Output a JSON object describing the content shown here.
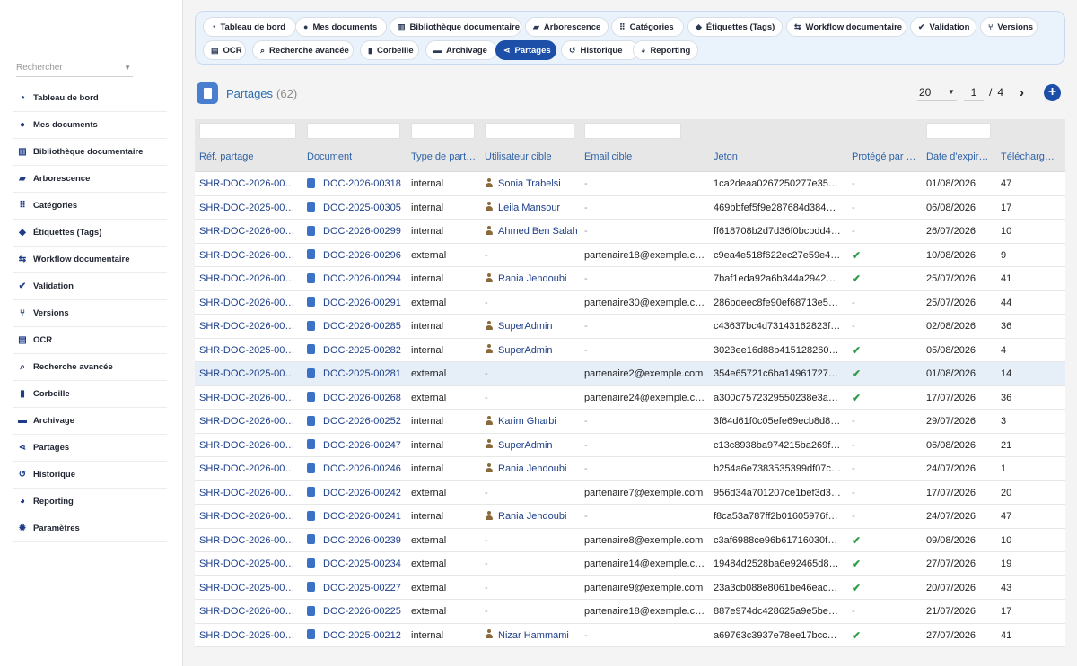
{
  "sidebar": {
    "search_placeholder": "Rechercher",
    "items": [
      {
        "label": "Tableau de bord",
        "icon": "dashboard-icon"
      },
      {
        "label": "Mes documents",
        "icon": "user-icon"
      },
      {
        "label": "Bibliothèque documentaire",
        "icon": "book-icon"
      },
      {
        "label": "Arborescence",
        "icon": "folder-icon"
      },
      {
        "label": "Catégories",
        "icon": "sitemap-icon"
      },
      {
        "label": "Étiquettes (Tags)",
        "icon": "tag-icon"
      },
      {
        "label": "Workflow documentaire",
        "icon": "workflow-icon"
      },
      {
        "label": "Validation",
        "icon": "check-circle-icon"
      },
      {
        "label": "Versions",
        "icon": "branch-icon"
      },
      {
        "label": "OCR",
        "icon": "file-text-icon"
      },
      {
        "label": "Recherche avancée",
        "icon": "search-icon"
      },
      {
        "label": "Corbeille",
        "icon": "trash-icon"
      },
      {
        "label": "Archivage",
        "icon": "archive-icon"
      },
      {
        "label": "Partages",
        "icon": "share-icon"
      },
      {
        "label": "Historique",
        "icon": "history-icon"
      },
      {
        "label": "Reporting",
        "icon": "pie-chart-icon"
      },
      {
        "label": "Paramètres",
        "icon": "gear-icon"
      }
    ]
  },
  "tabs": [
    {
      "label": "Tableau de bord",
      "icon": "dashboard-icon"
    },
    {
      "label": "Mes documents",
      "icon": "user-icon"
    },
    {
      "label": "Bibliothèque documentaire",
      "icon": "book-icon"
    },
    {
      "label": "Arborescence",
      "icon": "folder-icon"
    },
    {
      "label": "Catégories",
      "icon": "sitemap-icon"
    },
    {
      "label": "Étiquettes (Tags)",
      "icon": "tag-icon"
    },
    {
      "label": "Workflow documentaire",
      "icon": "workflow-icon"
    },
    {
      "label": "Validation",
      "icon": "check-circle-icon"
    },
    {
      "label": "Versions",
      "icon": "branch-icon"
    },
    {
      "label": "OCR",
      "icon": "file-text-icon"
    },
    {
      "label": "Recherche avancée",
      "icon": "search-icon"
    },
    {
      "label": "Corbeille",
      "icon": "trash-icon"
    },
    {
      "label": "Archivage",
      "icon": "archive-icon"
    },
    {
      "label": "Partages",
      "icon": "share-icon",
      "active": true
    },
    {
      "label": "Historique",
      "icon": "history-icon"
    },
    {
      "label": "Reporting",
      "icon": "pie-chart-icon"
    }
  ],
  "page": {
    "title": "Partages",
    "count": "(62)"
  },
  "pager": {
    "page_size": "20",
    "current": "1",
    "separator": "/",
    "total": "4"
  },
  "colors": {
    "accent": "#1d4fa8",
    "link": "#1c3f8a",
    "header_text": "#2f63a8",
    "check": "#2e9c4a"
  },
  "table": {
    "columns": [
      "Réf. partage",
      "Document",
      "Type de partage",
      "Utilisateur cible",
      "Email cible",
      "Jeton",
      "Protégé par mot de passe",
      "Date d'expiration",
      "Téléchargements"
    ],
    "highlight_row": 8,
    "rows": [
      {
        "ref": "SHR-DOC-2026-00318",
        "doc": "DOC-2026-00318",
        "type": "internal",
        "user": "Sonia Trabelsi",
        "email": "-",
        "token": "1ca2deaa0267250277e350…",
        "protected": "-",
        "date": "01/08/2026",
        "downloads": "47"
      },
      {
        "ref": "SHR-DOC-2025-00305",
        "doc": "DOC-2025-00305",
        "type": "internal",
        "user": "Leila Mansour",
        "email": "-",
        "token": "469bbfef5f9e287684d38400…",
        "protected": "-",
        "date": "06/08/2026",
        "downloads": "17"
      },
      {
        "ref": "SHR-DOC-2026-00299",
        "doc": "DOC-2026-00299",
        "type": "internal",
        "user": "Ahmed Ben Salah",
        "email": "-",
        "token": "ff618708b2d7d36f0bcbdd44…",
        "protected": "-",
        "date": "26/07/2026",
        "downloads": "10"
      },
      {
        "ref": "SHR-DOC-2026-00296",
        "doc": "DOC-2026-00296",
        "type": "external",
        "user": "-",
        "email": "partenaire18@exemple.com",
        "token": "c9ea4e518f622ec27e59e49…",
        "protected": "check",
        "date": "10/08/2026",
        "downloads": "9"
      },
      {
        "ref": "SHR-DOC-2026-00294",
        "doc": "DOC-2026-00294",
        "type": "internal",
        "user": "Rania Jendoubi",
        "email": "-",
        "token": "7baf1eda92a6b344a2942e8…",
        "protected": "check",
        "date": "25/07/2026",
        "downloads": "41"
      },
      {
        "ref": "SHR-DOC-2026-00291",
        "doc": "DOC-2026-00291",
        "type": "external",
        "user": "-",
        "email": "partenaire30@exemple.com",
        "token": "286bdeec8fe90ef68713e58f…",
        "protected": "-",
        "date": "25/07/2026",
        "downloads": "44"
      },
      {
        "ref": "SHR-DOC-2026-00285",
        "doc": "DOC-2026-00285",
        "type": "internal",
        "user": "SuperAdmin",
        "email": "-",
        "token": "c43637bc4d73143162823fc…",
        "protected": "-",
        "date": "02/08/2026",
        "downloads": "36"
      },
      {
        "ref": "SHR-DOC-2025-00282",
        "doc": "DOC-2025-00282",
        "type": "internal",
        "user": "SuperAdmin",
        "email": "-",
        "token": "3023ee16d88b4151282607…",
        "protected": "check",
        "date": "05/08/2026",
        "downloads": "4"
      },
      {
        "ref": "SHR-DOC-2025-00281",
        "doc": "DOC-2025-00281",
        "type": "external",
        "user": "-",
        "email": "partenaire2@exemple.com",
        "token": "354e65721c6ba149617270…",
        "protected": "check",
        "date": "01/08/2026",
        "downloads": "14"
      },
      {
        "ref": "SHR-DOC-2026-00268",
        "doc": "DOC-2026-00268",
        "type": "external",
        "user": "-",
        "email": "partenaire24@exemple.com",
        "token": "a300c7572329550238e3a4…",
        "protected": "check",
        "date": "17/07/2026",
        "downloads": "36"
      },
      {
        "ref": "SHR-DOC-2026-00252",
        "doc": "DOC-2026-00252",
        "type": "internal",
        "user": "Karim Gharbi",
        "email": "-",
        "token": "3f64d61f0c05efe69ecb8d8f…",
        "protected": "-",
        "date": "29/07/2026",
        "downloads": "3"
      },
      {
        "ref": "SHR-DOC-2026-00247",
        "doc": "DOC-2026-00247",
        "type": "internal",
        "user": "SuperAdmin",
        "email": "-",
        "token": "c13c8938ba974215ba269f6…",
        "protected": "-",
        "date": "06/08/2026",
        "downloads": "21"
      },
      {
        "ref": "SHR-DOC-2026-00246",
        "doc": "DOC-2026-00246",
        "type": "internal",
        "user": "Rania Jendoubi",
        "email": "-",
        "token": "b254a6e7383535399df07c5…",
        "protected": "-",
        "date": "24/07/2026",
        "downloads": "1"
      },
      {
        "ref": "SHR-DOC-2026-00242",
        "doc": "DOC-2026-00242",
        "type": "external",
        "user": "-",
        "email": "partenaire7@exemple.com",
        "token": "956d34a701207ce1bef3d37…",
        "protected": "-",
        "date": "17/07/2026",
        "downloads": "20"
      },
      {
        "ref": "SHR-DOC-2026-00241",
        "doc": "DOC-2026-00241",
        "type": "internal",
        "user": "Rania Jendoubi",
        "email": "-",
        "token": "f8ca53a787ff2b01605976f1…",
        "protected": "-",
        "date": "24/07/2026",
        "downloads": "47"
      },
      {
        "ref": "SHR-DOC-2026-00239",
        "doc": "DOC-2026-00239",
        "type": "external",
        "user": "-",
        "email": "partenaire8@exemple.com",
        "token": "c3af6988ce96b61716030fa…",
        "protected": "check",
        "date": "09/08/2026",
        "downloads": "10"
      },
      {
        "ref": "SHR-DOC-2025-00234",
        "doc": "DOC-2025-00234",
        "type": "external",
        "user": "-",
        "email": "partenaire14@exemple.com",
        "token": "19484d2528ba6e92465d87…",
        "protected": "check",
        "date": "27/07/2026",
        "downloads": "19"
      },
      {
        "ref": "SHR-DOC-2025-00227",
        "doc": "DOC-2025-00227",
        "type": "external",
        "user": "-",
        "email": "partenaire9@exemple.com",
        "token": "23a3cb088e8061be46eacb…",
        "protected": "check",
        "date": "20/07/2026",
        "downloads": "43"
      },
      {
        "ref": "SHR-DOC-2026-00225",
        "doc": "DOC-2026-00225",
        "type": "external",
        "user": "-",
        "email": "partenaire18@exemple.com",
        "token": "887e974dc428625a9e5be8…",
        "protected": "-",
        "date": "21/07/2026",
        "downloads": "17"
      },
      {
        "ref": "SHR-DOC-2025-00212",
        "doc": "DOC-2025-00212",
        "type": "internal",
        "user": "Nizar Hammami",
        "email": "-",
        "token": "a69763c3937e78ee17bcc5…",
        "protected": "check",
        "date": "27/07/2026",
        "downloads": "41"
      }
    ]
  }
}
